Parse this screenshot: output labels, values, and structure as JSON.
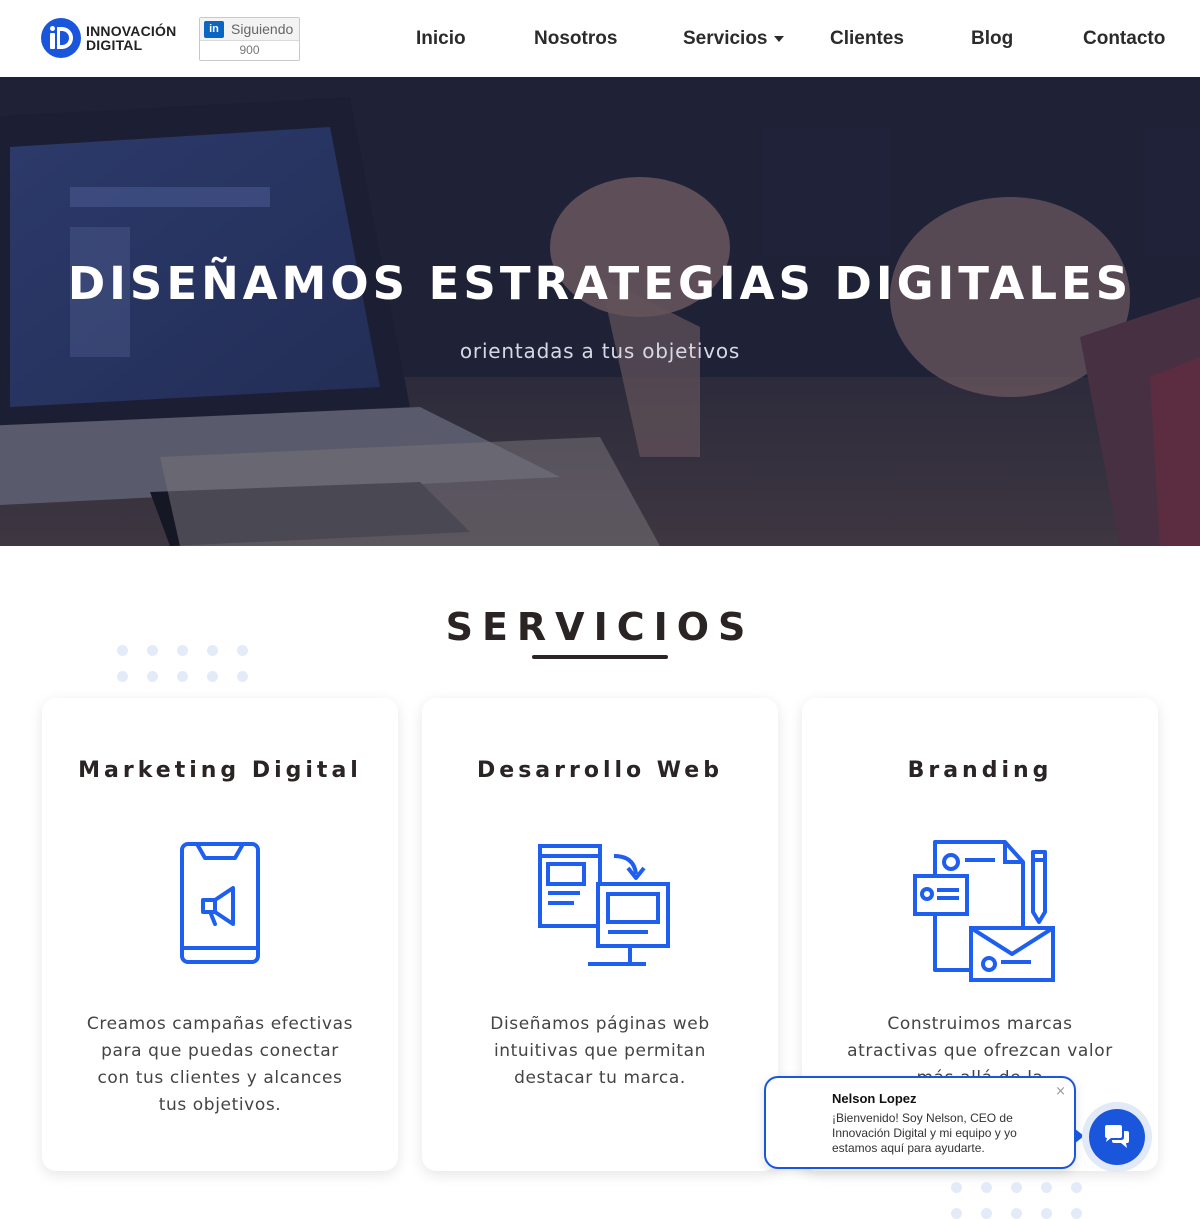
{
  "header": {
    "logo": {
      "line1": "INNOVACIÓN",
      "line2": "DIGITAL"
    },
    "linkedin": {
      "badge": "in",
      "label": "Siguiendo",
      "count": "900"
    },
    "nav": [
      {
        "label": "Inicio"
      },
      {
        "label": "Nosotros"
      },
      {
        "label": "Servicios",
        "has_dropdown": true
      },
      {
        "label": "Clientes"
      },
      {
        "label": "Blog"
      },
      {
        "label": "Contacto"
      }
    ]
  },
  "hero": {
    "title": "DISEÑAMOS ESTRATEGIAS DIGITALES",
    "subtitle": "orientadas a tus objetivos"
  },
  "services": {
    "title": "SERVICIOS",
    "cards": [
      {
        "title": "Marketing Digital",
        "icon": "smartphone-megaphone-icon",
        "text": "Creamos campañas efectivas para que puedas conectar con tus clientes y alcances tus objetivos."
      },
      {
        "title": "Desarrollo Web",
        "icon": "web-design-monitor-icon",
        "text": "Diseñamos páginas web intuitivas que permitan destacar tu marca."
      },
      {
        "title": "Branding",
        "icon": "brand-stationery-icon",
        "text": "Construimos marcas atractivas que ofrezcan valor más allá de la"
      }
    ]
  },
  "chat": {
    "name": "Nelson Lopez",
    "message": "¡Bienvenido! Soy Nelson, CEO de Innovación Digital y mi equipo y yo estamos aquí para ayudarte.",
    "close": "×",
    "button_icon": "chat-bubbles-icon"
  },
  "colors": {
    "brand_blue": "#1a56db",
    "icon_blue": "#1f5ff0",
    "heading": "#2a2424",
    "linkedin": "#0a66c2"
  }
}
